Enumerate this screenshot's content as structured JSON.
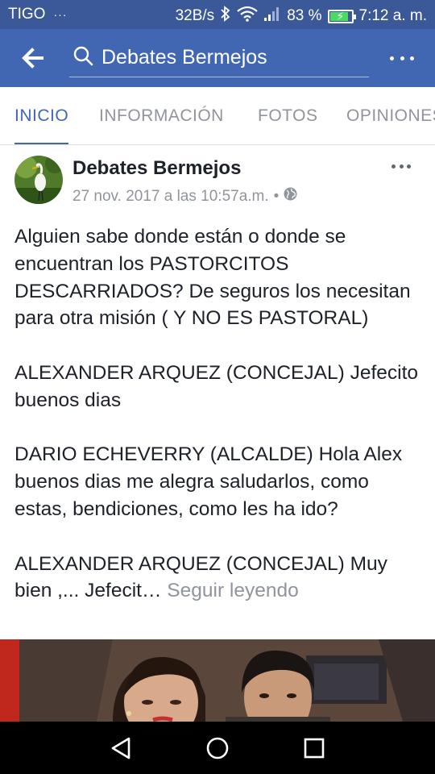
{
  "status_bar": {
    "carrier": "TIGO",
    "carrier_extra": "···",
    "speed": "32B/s",
    "battery": "83 %",
    "battery_level": 0.83,
    "time": "7:12 a. m.",
    "icons": [
      "bluetooth-icon",
      "wifi-icon",
      "signal-icon",
      "battery-icon"
    ]
  },
  "app_bar": {
    "search_text": "Debates Bermejos",
    "icons": [
      "back-arrow-icon",
      "search-icon",
      "more-icon"
    ]
  },
  "tabs": [
    {
      "label": "INICIO",
      "active": true
    },
    {
      "label": "INFORMACIÓN",
      "active": false
    },
    {
      "label": "FOTOS",
      "active": false
    },
    {
      "label": "OPINIONES",
      "active": false
    }
  ],
  "post": {
    "author": "Debates Bermejos",
    "date": "27 nov. 2017 a las 10:57a.m.",
    "separator": "•",
    "paragraphs": [
      "Alguien sabe donde están o donde se encuentran los PASTORCITOS DESCARRIADOS? De seguros los necesitan para otra misión ( Y NO ES PASTORAL)",
      "ALEXANDER ARQUEZ (CONCEJAL) Jefecito buenos dias",
      "DARIO ECHEVERRY (ALCALDE) Hola Alex buenos dias me alegra saludarlos, como estas, bendiciones, como les ha ido?"
    ],
    "last_paragraph": "ALEXANDER ARQUEZ (CONCEJAL) Muy bien ,... Jefecit…",
    "see_more": "Seguir leyendo"
  },
  "colors": {
    "status_bar": "#3b5998",
    "app_bar": "#4267b2",
    "accent": "#4267b2",
    "text": "#1d2129",
    "muted": "#90949c"
  }
}
